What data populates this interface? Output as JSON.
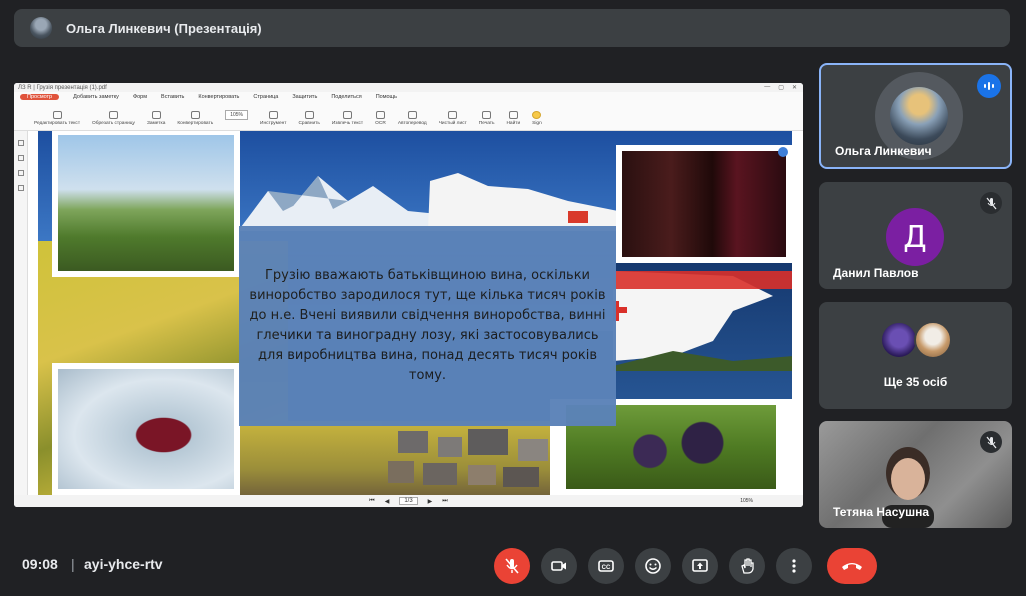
{
  "presenter_bar": {
    "title": "Ольга Линкевич (Презентація)"
  },
  "shared_screen": {
    "window_title": "ЛЗ R | Грузія презентація (1).pdf",
    "menu": [
      "Просмотр",
      "Добавить заметку",
      "Форм",
      "Вставить",
      "Конвертировать",
      "Страница",
      "Защитить",
      "Поделиться",
      "Помощь"
    ],
    "active_menu": "Просмотр",
    "toolbar": [
      "Редактировать текст",
      "Обрезать страницу",
      "Заметка",
      "Конвертировать",
      "Инструмент",
      "Сравнить",
      "Извлечь текст",
      "OCR",
      "Автоперевод",
      "Чистый лист",
      "Печать",
      "Найти",
      "Sign"
    ],
    "toolbar_zoom": "105%",
    "slide_text": "Грузію вважають батьківщиною вина, оскільки виноробство зародилося тут, ще кілька тисяч років до н.е. Вчені виявили свідчення виноробства, винні глечики та виноградну лозу, які застосовувались для виробництва вина, понад десять тисяч років тому.",
    "page_indicator": "1/3",
    "status_zoom": "105%"
  },
  "participants": [
    {
      "name": "Ольга Линкевич",
      "speaking": true
    },
    {
      "name": "Данил Павлов",
      "initial": "Д",
      "avatar_color": "#7b1fa2",
      "muted": true
    },
    {
      "more_label": "Ще 35 осіб"
    },
    {
      "name": "Тетяна Насушна",
      "muted": true
    }
  ],
  "bottom_bar": {
    "time": "09:08",
    "separator": "|",
    "meeting_code": "ayi-yhce-rtv",
    "controls": [
      "mic-off",
      "camera",
      "captions",
      "emoji",
      "present",
      "raise-hand",
      "more",
      "leave-call"
    ]
  }
}
